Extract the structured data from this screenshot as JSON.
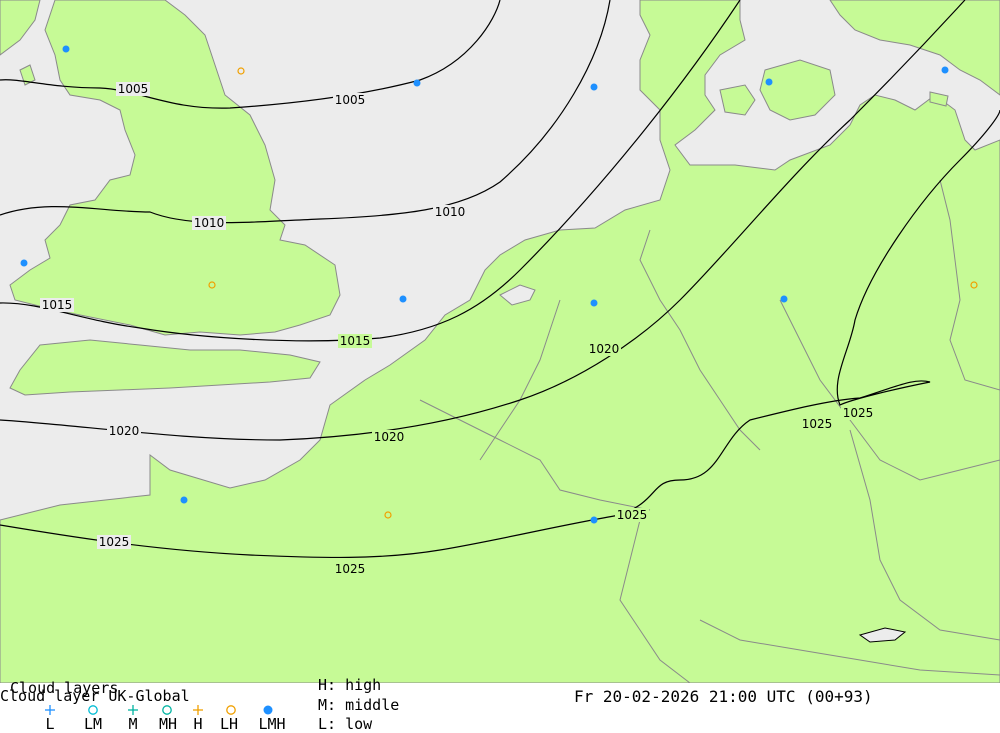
{
  "map": {
    "colors": {
      "sea": "#ececec",
      "land": "#c6fa96",
      "border": "#8a8a8a",
      "isobar": "#000000"
    },
    "isobar_labels": [
      {
        "key": "a",
        "text": "1005"
      },
      {
        "key": "b",
        "text": "1005"
      },
      {
        "key": "c",
        "text": "1010"
      },
      {
        "key": "d",
        "text": "1010"
      },
      {
        "key": "e",
        "text": "1015"
      },
      {
        "key": "f",
        "text": "1015"
      },
      {
        "key": "g",
        "text": "1020"
      },
      {
        "key": "h",
        "text": "1020"
      },
      {
        "key": "i",
        "text": "1020"
      },
      {
        "key": "j",
        "text": "1025"
      },
      {
        "key": "k",
        "text": "1025"
      },
      {
        "key": "l",
        "text": "1025"
      },
      {
        "key": "m",
        "text": "1025"
      },
      {
        "key": "n",
        "text": "1025"
      }
    ],
    "markers": [
      {
        "type": "LMH"
      },
      {
        "type": "LH"
      },
      {
        "type": "LMH"
      },
      {
        "type": "LMH"
      },
      {
        "type": "LMH"
      },
      {
        "type": "LMH"
      },
      {
        "type": "LH"
      },
      {
        "type": "LMH"
      },
      {
        "type": "LMH"
      },
      {
        "type": "LMH"
      },
      {
        "type": "LH"
      },
      {
        "type": "LMH"
      },
      {
        "type": "LH"
      },
      {
        "type": "LMH"
      },
      {
        "type": "LMH"
      }
    ]
  },
  "legend": {
    "title": "Cloud layers",
    "subtitle": "Cloud layer  UK-Global",
    "symbols": [
      {
        "label": "L",
        "icon": "plus-blue",
        "color": "#1e90ff"
      },
      {
        "label": "LM",
        "icon": "circle-cyan",
        "color": "#00bcd4"
      },
      {
        "label": "M",
        "icon": "plus-teal",
        "color": "#00b3a1"
      },
      {
        "label": "MH",
        "icon": "circle-teal",
        "color": "#00b3a1"
      },
      {
        "label": "H",
        "icon": "plus-orange",
        "color": "#f0a000"
      },
      {
        "label": "LH",
        "icon": "circle-orange",
        "color": "#f0a000"
      },
      {
        "label": "LMH",
        "icon": "dot-blue",
        "color": "#1e90ff"
      }
    ],
    "key": {
      "high": "H: high",
      "middle": "M: middle",
      "low": "L: low"
    },
    "datetime": "Fr 20-02-2026 21:00 UTC (00+93)"
  }
}
